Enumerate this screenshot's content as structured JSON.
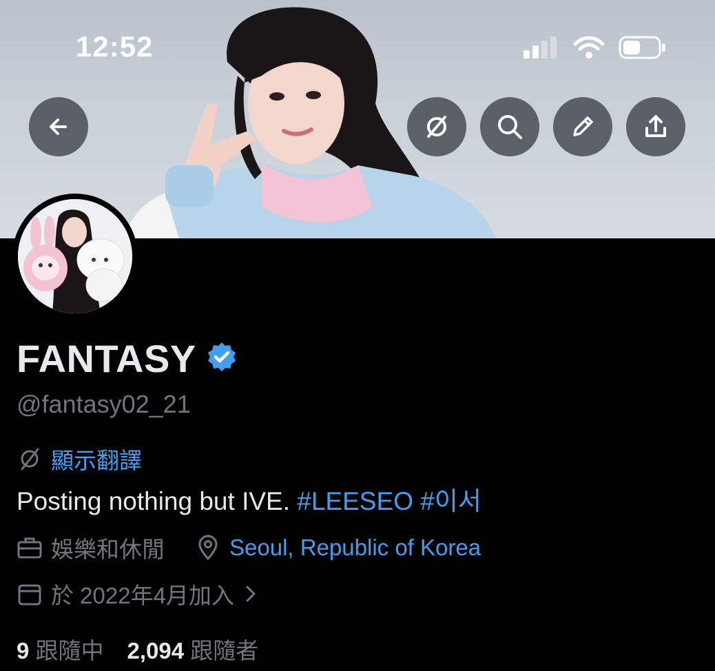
{
  "status_bar": {
    "time": "12:52"
  },
  "header_buttons": {
    "back": "back-arrow-icon",
    "translate": "translate-off-icon",
    "search": "search-icon",
    "edit": "pencil-icon",
    "share": "share-icon"
  },
  "profile": {
    "display_name": "FANTASY",
    "verified": true,
    "handle": "@fantasy02_21",
    "translate_label": "顯示翻譯",
    "bio_text": "Posting nothing but IVE. ",
    "bio_tags": [
      "#LEESEO",
      "#이서"
    ],
    "category": "娛樂和休閒",
    "location": "Seoul, Republic of Korea",
    "joined": "於 2022年4月加入",
    "following_count": "9",
    "following_label": "跟隨中",
    "followers_count": "2,094",
    "followers_label": "跟隨者"
  },
  "colors": {
    "accent": "#3f9ff0",
    "muted": "#71767b",
    "text": "#e7e9ea",
    "background": "#000000"
  }
}
